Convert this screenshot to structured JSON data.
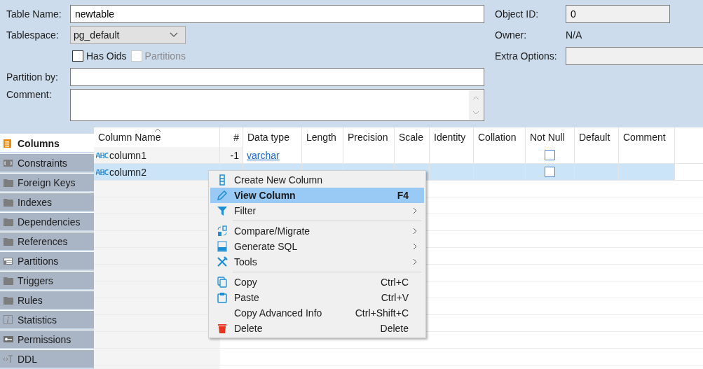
{
  "form": {
    "table_name": {
      "label": "Table Name:",
      "value": "newtable"
    },
    "tablespace": {
      "label": "Tablespace:",
      "value": "pg_default"
    },
    "checkboxes": [
      {
        "label": "Has Oids",
        "checked": false,
        "disabled": false
      },
      {
        "label": "Partitions",
        "checked": false,
        "disabled": true
      }
    ],
    "partition_by": {
      "label": "Partition by:"
    },
    "comment": {
      "label": "Comment:"
    },
    "object_id": {
      "label": "Object ID:",
      "value": "0"
    },
    "owner": {
      "label": "Owner:",
      "value": "N/A"
    },
    "extra_options": {
      "label": "Extra Options:"
    }
  },
  "tabs": [
    {
      "label": "Columns",
      "selected": true
    },
    {
      "label": "Constraints",
      "selected": false
    },
    {
      "label": "Foreign Keys",
      "selected": false
    },
    {
      "label": "Indexes",
      "selected": false
    },
    {
      "label": "Dependencies",
      "selected": false
    },
    {
      "label": "References",
      "selected": false
    },
    {
      "label": "Partitions",
      "selected": false
    },
    {
      "label": "Triggers",
      "selected": false
    },
    {
      "label": "Rules",
      "selected": false
    },
    {
      "label": "Statistics",
      "selected": false
    },
    {
      "label": "Permissions",
      "selected": false
    },
    {
      "label": "DDL",
      "selected": false
    }
  ],
  "table": {
    "columns": [
      "Column Name",
      "#",
      "Data type",
      "Length",
      "Precision",
      "Scale",
      "Identity",
      "Collation",
      "Not Null",
      "Default",
      "Comment"
    ],
    "rows": [
      {
        "name": "column1",
        "number": "-1",
        "data_type": "varchar",
        "not_null": false,
        "selected": false
      },
      {
        "name": "column2",
        "not_null": false,
        "selected": true
      }
    ]
  },
  "context_menu": [
    {
      "kind": "item",
      "label": "Create New Column",
      "selected": false
    },
    {
      "kind": "item",
      "label": "View Column",
      "shortcut": "F4",
      "selected": true
    },
    {
      "kind": "item",
      "label": "Filter",
      "submenu": true,
      "selected": false
    },
    {
      "kind": "separator"
    },
    {
      "kind": "item",
      "label": "Compare/Migrate",
      "submenu": true,
      "selected": false
    },
    {
      "kind": "item",
      "label": "Generate SQL",
      "submenu": true,
      "selected": false
    },
    {
      "kind": "item",
      "label": "Tools",
      "submenu": true,
      "selected": false
    },
    {
      "kind": "separator"
    },
    {
      "kind": "item",
      "label": "Copy",
      "shortcut": "Ctrl+C",
      "selected": false
    },
    {
      "kind": "item",
      "label": "Paste",
      "shortcut": "Ctrl+V",
      "selected": false
    },
    {
      "kind": "item",
      "label": "Copy Advanced Info",
      "shortcut": "Ctrl+Shift+C",
      "selected": false
    },
    {
      "kind": "item",
      "label": "Delete",
      "shortcut": "Delete",
      "selected": false
    }
  ]
}
